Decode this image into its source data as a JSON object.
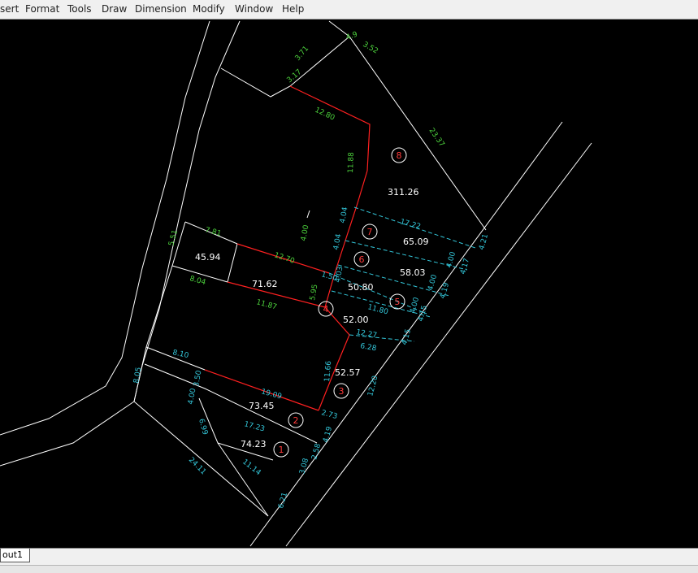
{
  "menu": [
    "sert",
    "Format",
    "Tools",
    "Draw",
    "Dimension",
    "Modify",
    "Window",
    "Help"
  ],
  "layout_tab": "out1",
  "areas": [
    "311.26",
    "65.09",
    "58.03",
    "50.80",
    "45.94",
    "71.62",
    "52.00",
    "52.57",
    "73.45",
    "74.23"
  ],
  "lot_numbers": [
    "8",
    "7",
    "6",
    "5",
    "4",
    "3",
    "2",
    "1"
  ],
  "green_dims": [
    "3.17",
    "3.71",
    "4.9",
    "3.52",
    "12.80",
    "11.88",
    "4.00",
    "5.51",
    "7.81",
    "12.70",
    "8.04",
    "11.87",
    "5.95",
    "23.37"
  ],
  "cyan_dims": [
    "17.22",
    "4.04",
    "4.04",
    "4.03",
    "1.50",
    "4.00",
    "4.17",
    "4.21",
    "4.00",
    "4.19",
    "11.80",
    "4.15",
    "4.00",
    "12.27",
    "4.15",
    "6.28",
    "11.66",
    "12.20",
    "8.10",
    "3.50",
    "8.05",
    "19.09",
    "2.73",
    "4.00",
    "17.23",
    "4.19",
    "6.99",
    "24.11",
    "11.14",
    "3.08",
    "2.58",
    "6.21"
  ],
  "colors": {
    "boundary": "#ffffff",
    "lot_line": "#ff2020",
    "green_text": "#4cd13c",
    "cyan_text": "#33c6d9",
    "background": "#000000"
  }
}
